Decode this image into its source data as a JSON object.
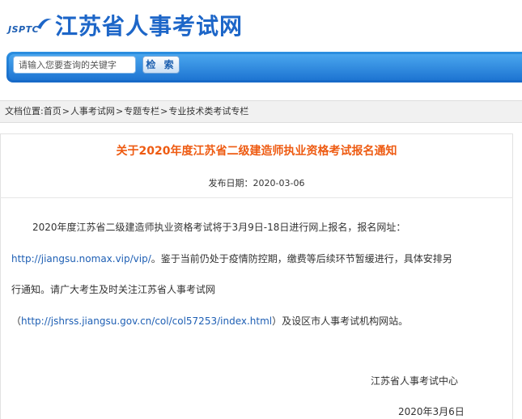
{
  "header": {
    "logo_text": "JSPTC",
    "site_title": "江苏省人事考试网"
  },
  "search": {
    "placeholder": "请输入您要查询的关键字",
    "button_label": "检 索"
  },
  "breadcrumb": {
    "prefix": "文档位置:",
    "items": [
      "首页",
      "人事考试网",
      "专题专栏",
      "专业技术类考试专栏"
    ],
    "separator": ">"
  },
  "article": {
    "title": "关于2020年度江苏省二级建造师执业资格考试报名通知",
    "date_label": "发布日期：",
    "date_value": "2020-03-06",
    "line1": "2020年度江苏省二级建造师执业资格考试将于3月9日-18日进行网上报名，报名网址：",
    "line2_link": "http://jiangsu.nomax.vip/vip/",
    "line2_text": "。鉴于当前仍处于疫情防控期，缴费等后续环节暂缓进行，具体安排另",
    "line3": "行通知。请广大考生及时关注江苏省人事考试网",
    "line4_open": "（",
    "line4_link": "http://jshrss.jiangsu.gov.cn/col/col57253/index.html",
    "line4_text": "）及设区市人事考试机构网站。",
    "signature": "江苏省人事考试中心",
    "sign_date": "2020年3月6日"
  },
  "colors": {
    "brand_blue": "#1d66c8",
    "title_orange": "#ee5b12",
    "link_blue": "#1e5fb4"
  }
}
